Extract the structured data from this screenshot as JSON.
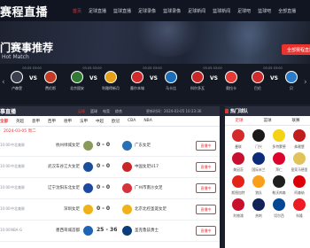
{
  "brand": "赛程直播",
  "nav": [
    {
      "label": "首页",
      "active": true
    },
    {
      "label": "足球直播"
    },
    {
      "label": "篮球直播"
    },
    {
      "label": "足球录像"
    },
    {
      "label": "篮球录像"
    },
    {
      "label": "足球新闻"
    },
    {
      "label": "篮球新闻"
    },
    {
      "label": "足球吧"
    },
    {
      "label": "篮球吧"
    },
    {
      "label": "全部直播"
    }
  ],
  "hero": {
    "title": "门赛事推荐",
    "subtitle": "Hot Match",
    "button": "全部赛程直播"
  },
  "strip_matches": [
    {
      "time": "03-05 03:00",
      "home": "卢森堡",
      "away": "费伦斯",
      "home_color": "#3a3f4d",
      "away_color": "#c23b22"
    },
    {
      "time": "03-05 03:00",
      "home": "北京国安",
      "away": "利雅得新月",
      "home_color": "#2f7a35",
      "away_color": "#e5a01a"
    },
    {
      "time": "03-05 03:00",
      "home": "墨尔本城",
      "away": "马卡比",
      "home_color": "#d12a2a",
      "away_color": "#1b6fb8"
    },
    {
      "time": "03-05 03:00",
      "home": "科尔多瓦",
      "away": "奥拉卡",
      "home_color": "#c62828",
      "away_color": "#e53935"
    },
    {
      "time": "03-05 03:00",
      "home": "巴伦",
      "away": "贝",
      "home_color": "#cf2b2b",
      "away_color": "#2a7bc9"
    }
  ],
  "live": {
    "title": "事直播",
    "tabs": [
      "足球",
      "篮球",
      "电竞",
      "综合"
    ],
    "active_tab": 0,
    "updated": "更新时间：2024-03-05 10:23:36",
    "leagues": [
      "全部",
      "英超",
      "意甲",
      "西甲",
      "德甲",
      "法甲",
      "中超",
      "欧冠",
      "CBA",
      "NBA"
    ],
    "date": "2024-03-05 周二",
    "rows": [
      {
        "time": "10:00",
        "league": "中北美联",
        "home": "杭州绿城女足",
        "score": "0 - 0",
        "away": "广东女足",
        "btn": "直播中",
        "hc": "#8a9a5b",
        "ac": "#2a6fb0"
      },
      {
        "time": "10:00",
        "league": "中北美联",
        "home": "武汉车谷江大女足",
        "score": "0 - 0",
        "away": "中国女足U17",
        "btn": "直播中",
        "hc": "#1a4f9c",
        "ac": "#c62828"
      },
      {
        "time": "10:00",
        "league": "中北美联",
        "home": "辽宁沈阳东北女足",
        "score": "0 - 0",
        "away": "广州市南沙女足",
        "btn": "直播中",
        "hc": "#1d4aa0",
        "ac": "#d4353b"
      },
      {
        "time": "10:00",
        "league": "中北美联",
        "home": "深圳女足",
        "score": "0 - 0",
        "away": "北京北控圣诞女足",
        "btn": "直播中",
        "hc": "#f0b21a",
        "ac": "#f0b21a"
      },
      {
        "time": "10:00",
        "league": "NBA-G",
        "home": "墨西哥城首都",
        "score": "25 - 36",
        "away": "圣克鲁兹勇士",
        "btn": "直播中",
        "hc": "#1e63b5",
        "ac": "#0d3d78"
      }
    ]
  },
  "hot_teams": {
    "title": "热门球队",
    "tabs": [
      "足球",
      "篮球",
      "联赛"
    ],
    "active_tab": 0,
    "clubs": [
      {
        "name": "曼联",
        "color": "#d42a2a"
      },
      {
        "name": "门兴",
        "color": "#1a1a1a"
      },
      {
        "name": "多特蒙德",
        "color": "#f4d314"
      },
      {
        "name": "弗赖堡",
        "color": "#c21d1d"
      },
      {
        "name": "美因茨",
        "color": "#c8102e"
      },
      {
        "name": "国际米兰",
        "color": "#0d2b7a"
      },
      {
        "name": "拜仁",
        "color": "#dc052d"
      },
      {
        "name": "皇家马德里",
        "color": "#e1c35a"
      },
      {
        "name": "斯图加特",
        "color": "#e32219"
      },
      {
        "name": "狼队",
        "color": "#f9a01b"
      },
      {
        "name": "勒沃库森",
        "color": "#1e1e1e"
      },
      {
        "name": "阿森纳",
        "color": "#db0007"
      },
      {
        "name": "利物浦",
        "color": "#c8102e"
      },
      {
        "name": "热刺",
        "color": "#132257"
      },
      {
        "name": "切尔西",
        "color": "#034694"
      },
      {
        "name": "科隆",
        "color": "#ed1c24"
      }
    ]
  }
}
